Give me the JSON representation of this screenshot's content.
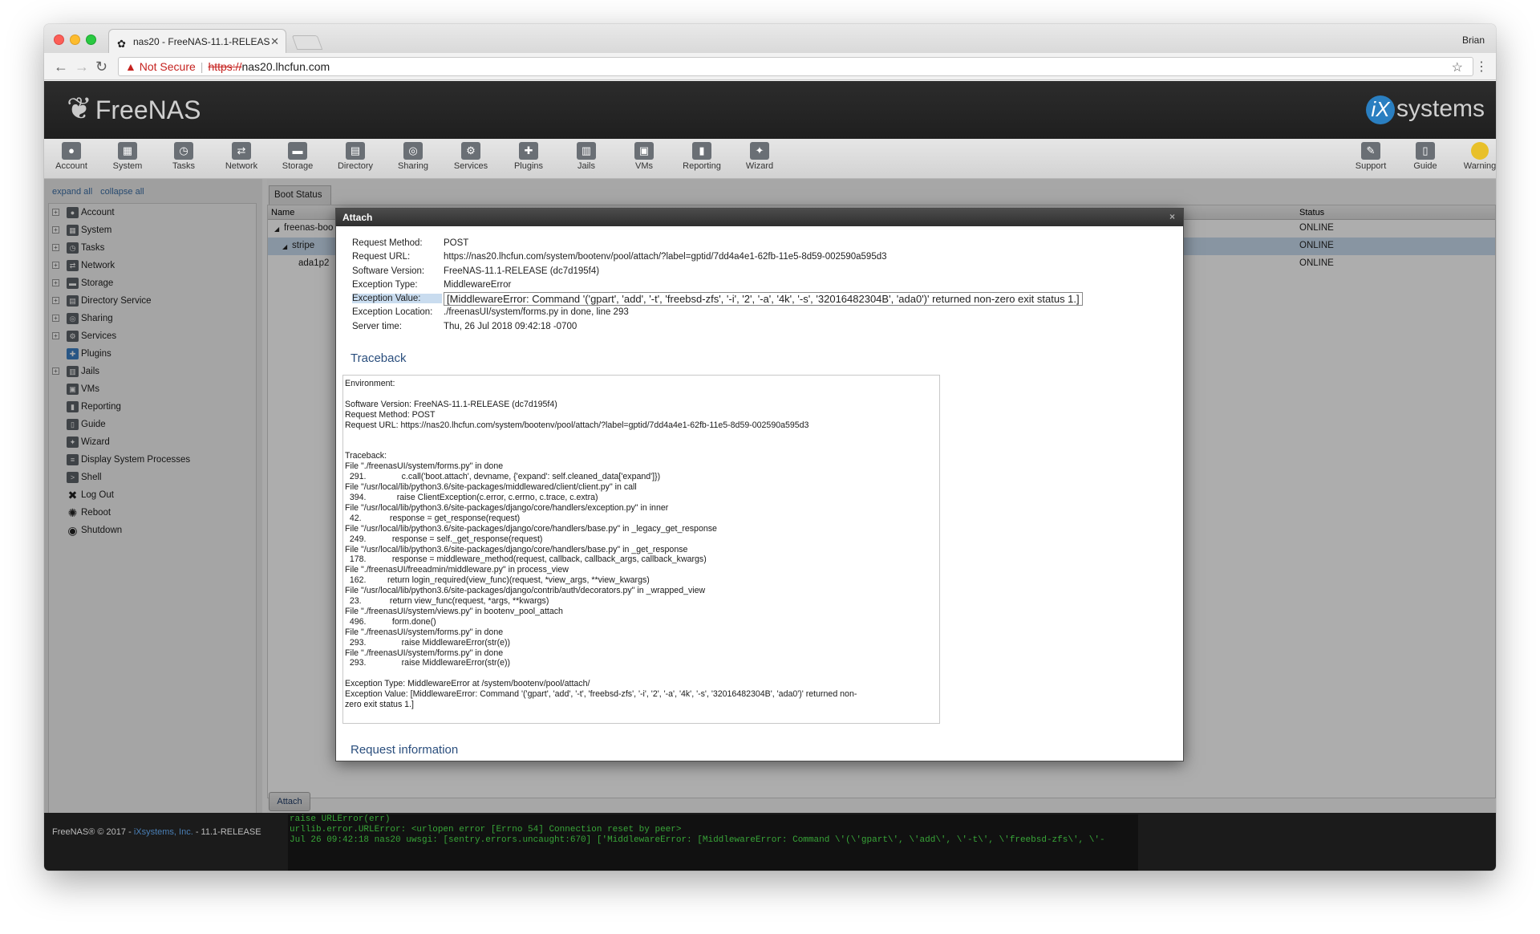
{
  "browser": {
    "tab_title": "nas20 - FreeNAS-11.1-RELEAS",
    "user": "Brian",
    "security_label": "Not Secure",
    "url_scheme": "https://",
    "url_host": "nas20.lhcfun.com"
  },
  "header": {
    "logo_text": "FreeNAS",
    "brand_text": "systems",
    "brand_mark": "iX"
  },
  "toolbar": {
    "items": [
      {
        "label": "Account",
        "icon": "account-icon"
      },
      {
        "label": "System",
        "icon": "system-icon"
      },
      {
        "label": "Tasks",
        "icon": "tasks-icon"
      },
      {
        "label": "Network",
        "icon": "network-icon"
      },
      {
        "label": "Storage",
        "icon": "storage-icon"
      },
      {
        "label": "Directory",
        "icon": "directory-icon"
      },
      {
        "label": "Sharing",
        "icon": "sharing-icon"
      },
      {
        "label": "Services",
        "icon": "services-icon"
      },
      {
        "label": "Plugins",
        "icon": "plugins-icon"
      },
      {
        "label": "Jails",
        "icon": "jails-icon"
      },
      {
        "label": "VMs",
        "icon": "vms-icon"
      },
      {
        "label": "Reporting",
        "icon": "reporting-icon"
      },
      {
        "label": "Wizard",
        "icon": "wizard-icon"
      }
    ],
    "right_items": [
      {
        "label": "Support",
        "icon": "support-icon"
      },
      {
        "label": "Guide",
        "icon": "guide-icon"
      },
      {
        "label": "Warning",
        "icon": "warning-icon"
      }
    ]
  },
  "sidebar": {
    "expand_all": "expand all",
    "collapse_all": "collapse all",
    "items": [
      {
        "label": "Account",
        "expandable": true
      },
      {
        "label": "System",
        "expandable": true
      },
      {
        "label": "Tasks",
        "expandable": true
      },
      {
        "label": "Network",
        "expandable": true
      },
      {
        "label": "Storage",
        "expandable": true
      },
      {
        "label": "Directory Service",
        "expandable": true
      },
      {
        "label": "Sharing",
        "expandable": true
      },
      {
        "label": "Services",
        "expandable": true
      },
      {
        "label": "Plugins",
        "expandable": false
      },
      {
        "label": "Jails",
        "expandable": true
      },
      {
        "label": "VMs",
        "expandable": false
      },
      {
        "label": "Reporting",
        "expandable": false
      },
      {
        "label": "Guide",
        "expandable": false
      },
      {
        "label": "Wizard",
        "expandable": false
      },
      {
        "label": "Display System Processes",
        "expandable": false
      },
      {
        "label": "Shell",
        "expandable": false
      },
      {
        "label": "Log Out",
        "expandable": false
      },
      {
        "label": "Reboot",
        "expandable": false
      },
      {
        "label": "Shutdown",
        "expandable": false
      }
    ]
  },
  "content": {
    "tab_label": "Boot Status",
    "columns": {
      "name": "Name",
      "status": "Status"
    },
    "rows": [
      {
        "name": "freenas-boo",
        "status": "ONLINE",
        "indent": 0,
        "toggle": "◢"
      },
      {
        "name": "stripe",
        "status": "ONLINE",
        "indent": 1,
        "toggle": "◢"
      },
      {
        "name": "ada1p2",
        "status": "ONLINE",
        "indent": 2,
        "toggle": ""
      }
    ],
    "attach_button": "Attach"
  },
  "footer": {
    "copyright": "FreeNAS® © 2017 - ",
    "company": "iXsystems, Inc.",
    "version": " - 11.1-RELEASE",
    "console_lines": [
      "raise URLError(err)",
      "urllib.error.URLError: <urlopen error [Errno 54] Connection reset by peer>",
      "Jul 26 09:42:18 nas20 uwsgi: [sentry.errors.uncaught:670] ['MiddlewareError: [MiddlewareError: Command \\'(\\'gpart\\', \\'add\\', \\'-t\\', \\'freebsd-zfs\\', \\'-"
    ]
  },
  "dialog": {
    "title": "Attach",
    "close": "×",
    "meta": [
      {
        "key": "Request Method:",
        "value": "POST"
      },
      {
        "key": "Request URL:",
        "value": "https://nas20.lhcfun.com/system/bootenv/pool/attach/?label=gptid/7dd4a4e1-62fb-11e5-8d59-002590a595d3"
      },
      {
        "key": "Software Version:",
        "value": "FreeNAS-11.1-RELEASE (dc7d195f4)"
      },
      {
        "key": "Exception Type:",
        "value": "MiddlewareError"
      },
      {
        "key": "Exception Value:",
        "value": "[MiddlewareError: Command '('gpart', 'add', '-t', 'freebsd-zfs', '-i', '2', '-a', '4k', '-s', '32016482304B', 'ada0')' returned non-zero exit status 1.]"
      },
      {
        "key": "Exception Location:",
        "value": "./freenasUI/system/forms.py in done, line 293"
      },
      {
        "key": "Server time:",
        "value": "Thu, 26 Jul 2018 09:42:18 -0700"
      }
    ],
    "traceback_heading": "Traceback",
    "traceback_text": "Environment:\n\nSoftware Version: FreeNAS-11.1-RELEASE (dc7d195f4)\nRequest Method: POST\nRequest URL: https://nas20.lhcfun.com/system/bootenv/pool/attach/?label=gptid/7dd4a4e1-62fb-11e5-8d59-002590a595d3\n\n\nTraceback:\nFile \"./freenasUI/system/forms.py\" in done\n  291.               c.call('boot.attach', devname, {'expand': self.cleaned_data['expand']})\nFile \"/usr/local/lib/python3.6/site-packages/middlewared/client/client.py\" in call\n  394.             raise ClientException(c.error, c.errno, c.trace, c.extra)\nFile \"/usr/local/lib/python3.6/site-packages/django/core/handlers/exception.py\" in inner\n  42.            response = get_response(request)\nFile \"/usr/local/lib/python3.6/site-packages/django/core/handlers/base.py\" in _legacy_get_response\n  249.           response = self._get_response(request)\nFile \"/usr/local/lib/python3.6/site-packages/django/core/handlers/base.py\" in _get_response\n  178.           response = middleware_method(request, callback, callback_args, callback_kwargs)\nFile \"./freenasUI/freeadmin/middleware.py\" in process_view\n  162.         return login_required(view_func)(request, *view_args, **view_kwargs)\nFile \"/usr/local/lib/python3.6/site-packages/django/contrib/auth/decorators.py\" in _wrapped_view\n  23.            return view_func(request, *args, **kwargs)\nFile \"./freenasUI/system/views.py\" in bootenv_pool_attach\n  496.           form.done()\nFile \"./freenasUI/system/forms.py\" in done\n  293.               raise MiddlewareError(str(e))\nFile \"./freenasUI/system/forms.py\" in done\n  293.               raise MiddlewareError(str(e))\n\nException Type: MiddlewareError at /system/bootenv/pool/attach/\nException Value: [MiddlewareError: Command '('gpart', 'add', '-t', 'freebsd-zfs', '-i', '2', '-a', '4k', '-s', '32016482304B', 'ada0')' returned non-\nzero exit status 1.]",
    "request_info_heading": "Request information"
  }
}
